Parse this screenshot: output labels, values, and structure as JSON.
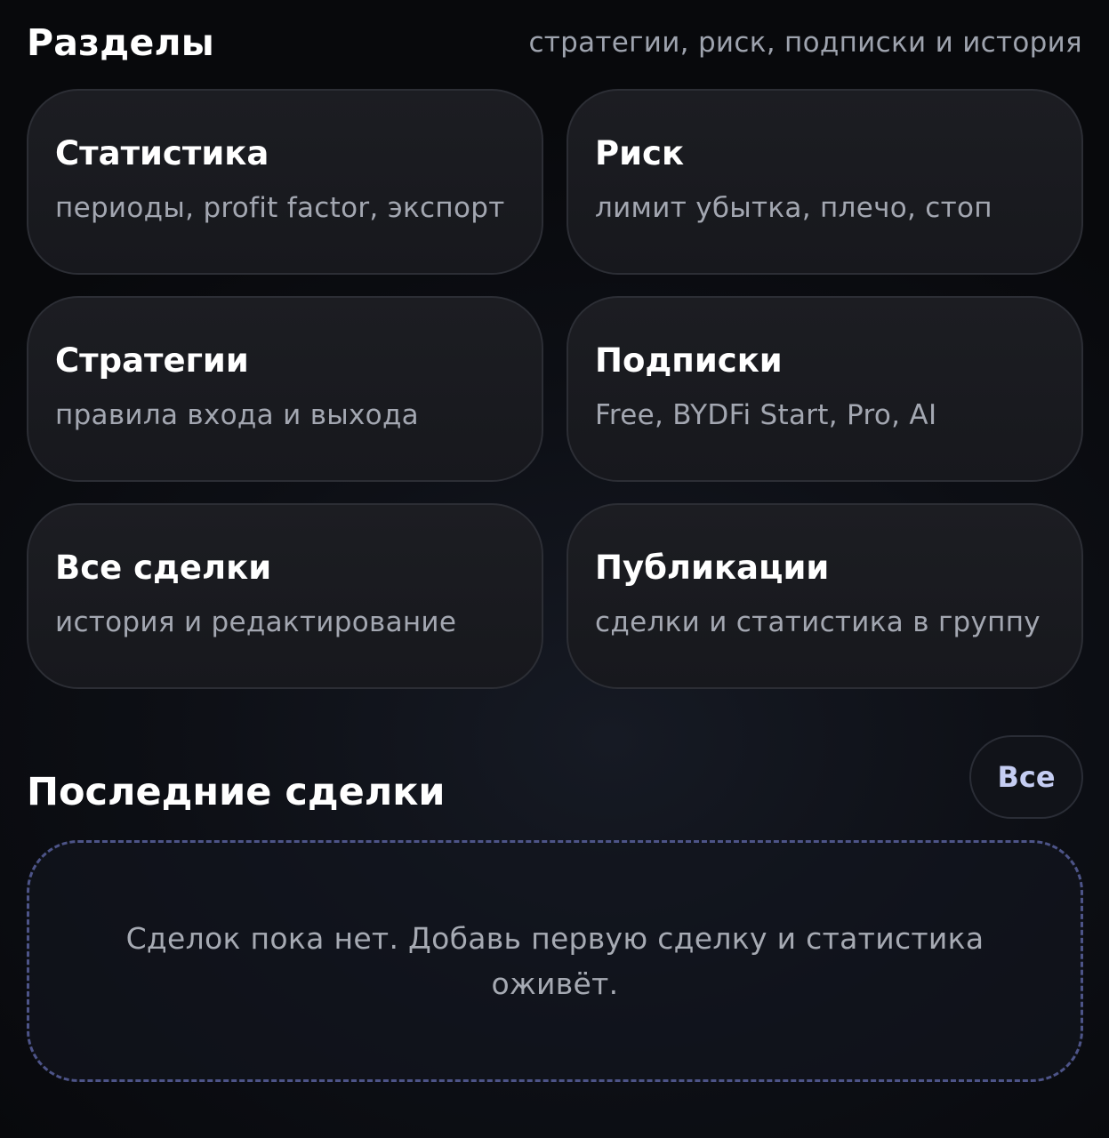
{
  "sections": {
    "title": "Разделы",
    "subtitle": "стратегии, риск, подписки и история",
    "cards": [
      {
        "title": "Статистика",
        "desc": "периоды, profit factor, экспорт"
      },
      {
        "title": "Риск",
        "desc": "лимит убытка, плечо, стоп"
      },
      {
        "title": "Стратегии",
        "desc": "правила входа и выхода"
      },
      {
        "title": "Подписки",
        "desc": "Free, BYDFi Start, Pro, AI"
      },
      {
        "title": "Все сделки",
        "desc": "история и редактирование"
      },
      {
        "title": "Публикации",
        "desc": "сделки и статистика в группу"
      }
    ]
  },
  "recent": {
    "title": "Последние сделки",
    "all_label": "Все",
    "empty_text": "Сделок пока нет. Добавь первую сделку и статистика оживёт."
  },
  "colors": {
    "background": "#0d0f15",
    "card_background": "#1a1b20",
    "card_border": "#2c2e35",
    "dashed_border": "#4d5488",
    "accent_text": "#c5cdf2",
    "muted_text": "#a3a7b1"
  }
}
